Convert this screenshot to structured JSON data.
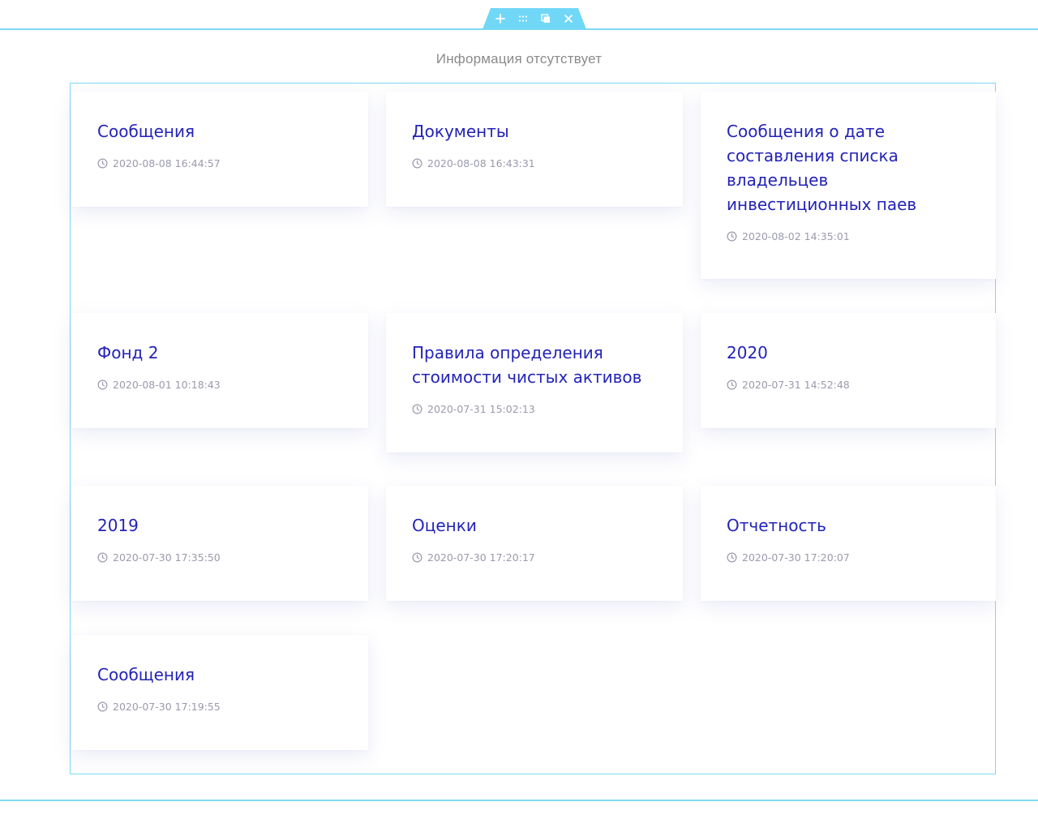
{
  "empty_message": "Информация отсутствует",
  "handle": {
    "icons": [
      "plus-icon",
      "grip-icon",
      "duplicate-icon",
      "close-icon"
    ]
  },
  "colors": {
    "accent_line": "#7fd8f0",
    "title": "#2323b8",
    "date": "#9a9aae"
  },
  "cards": [
    {
      "title": "Сообщения",
      "date": "2020-08-08 16:44:57"
    },
    {
      "title": "Документы",
      "date": "2020-08-08 16:43:31"
    },
    {
      "title": "Сообщения о дате составления списка владельцев инвестиционных паев",
      "date": "2020-08-02 14:35:01"
    },
    {
      "title": "Фонд 2",
      "date": "2020-08-01 10:18:43"
    },
    {
      "title": "Правила определения стоимости чистых активов",
      "date": "2020-07-31 15:02:13"
    },
    {
      "title": "2020",
      "date": "2020-07-31 14:52:48"
    },
    {
      "title": "2019",
      "date": "2020-07-30 17:35:50"
    },
    {
      "title": "Оценки",
      "date": "2020-07-30 17:20:17"
    },
    {
      "title": "Отчетность",
      "date": "2020-07-30 17:20:07"
    },
    {
      "title": "Сообщения",
      "date": "2020-07-30 17:19:55"
    }
  ]
}
